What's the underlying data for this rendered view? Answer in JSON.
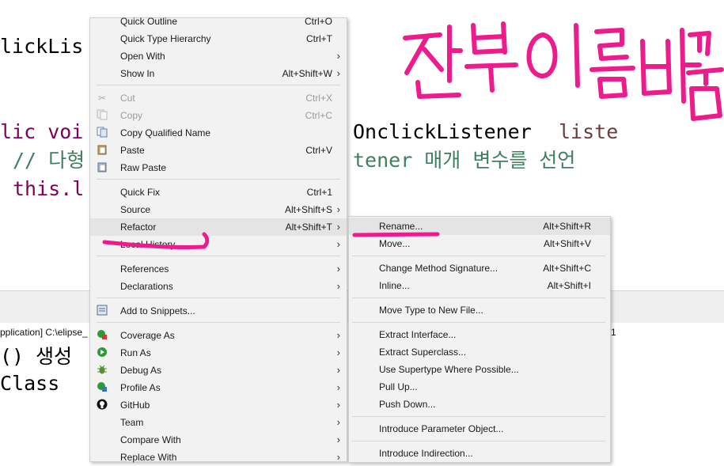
{
  "editor": {
    "line1": "lickLis",
    "line2_kw": "lic voi",
    "line2_rest": "OnclickListener",
    "line2_param": "liste",
    "line3_comment_a": "// 다형",
    "line3_comment_b": "tener 매개 변수를 선언",
    "line4": "this.l",
    "line5": "() 생성",
    "line6": "Class"
  },
  "console": {
    "header_text": "pplication] C:\\elipse_",
    "right_text": "1"
  },
  "context_menu": {
    "items": [
      {
        "label": "Quick Outline",
        "accel": "Ctrl+O"
      },
      {
        "label": "Quick Type Hierarchy",
        "accel": "Ctrl+T"
      },
      {
        "label": "Open With",
        "accel": ""
      },
      {
        "label": "Show In",
        "accel": "Alt+Shift+W"
      },
      {
        "label": "Cut",
        "accel": "Ctrl+X"
      },
      {
        "label": "Copy",
        "accel": "Ctrl+C"
      },
      {
        "label": "Copy Qualified Name",
        "accel": ""
      },
      {
        "label": "Paste",
        "accel": "Ctrl+V"
      },
      {
        "label": "Raw Paste",
        "accel": ""
      },
      {
        "label": "Quick Fix",
        "accel": "Ctrl+1"
      },
      {
        "label": "Source",
        "accel": "Alt+Shift+S"
      },
      {
        "label": "Refactor",
        "accel": "Alt+Shift+T"
      },
      {
        "label": "Local History",
        "accel": ""
      },
      {
        "label": "References",
        "accel": ""
      },
      {
        "label": "Declarations",
        "accel": ""
      },
      {
        "label": "Add to Snippets...",
        "accel": ""
      },
      {
        "label": "Coverage As",
        "accel": ""
      },
      {
        "label": "Run As",
        "accel": ""
      },
      {
        "label": "Debug As",
        "accel": ""
      },
      {
        "label": "Profile As",
        "accel": ""
      },
      {
        "label": "GitHub",
        "accel": ""
      },
      {
        "label": "Team",
        "accel": ""
      },
      {
        "label": "Compare With",
        "accel": ""
      },
      {
        "label": "Replace With",
        "accel": ""
      }
    ]
  },
  "refactor_menu": {
    "items": [
      {
        "label": "Rename...",
        "accel": "Alt+Shift+R"
      },
      {
        "label": "Move...",
        "accel": "Alt+Shift+V"
      },
      {
        "label": "Change Method Signature...",
        "accel": "Alt+Shift+C"
      },
      {
        "label": "Inline...",
        "accel": "Alt+Shift+I"
      },
      {
        "label": "Move Type to New File...",
        "accel": ""
      },
      {
        "label": "Extract Interface...",
        "accel": ""
      },
      {
        "label": "Extract Superclass...",
        "accel": ""
      },
      {
        "label": "Use Supertype Where Possible...",
        "accel": ""
      },
      {
        "label": "Pull Up...",
        "accel": ""
      },
      {
        "label": "Push Down...",
        "accel": ""
      },
      {
        "label": "Introduce Parameter Object...",
        "accel": ""
      },
      {
        "label": "Introduce Indirection...",
        "accel": ""
      }
    ]
  },
  "colors": {
    "annotation": "#ee1b8c",
    "keyword": "#7f0055",
    "comment": "#3f7f5f"
  }
}
